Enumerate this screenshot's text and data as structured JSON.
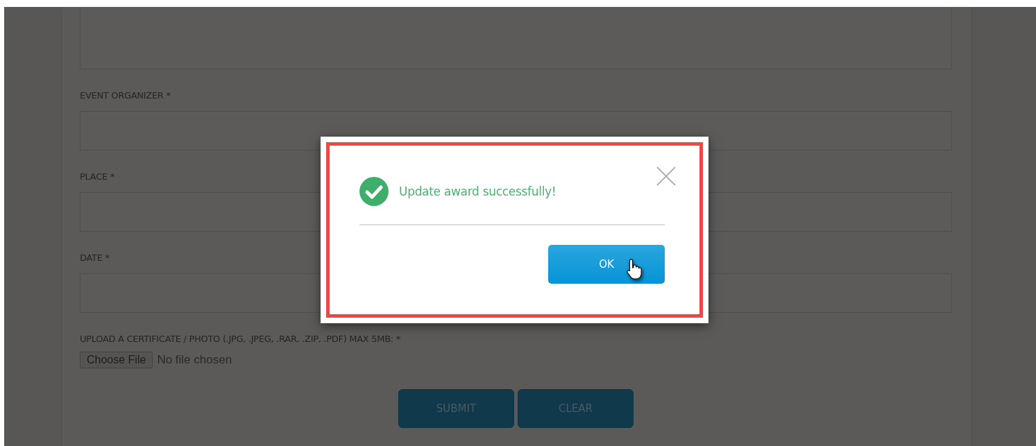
{
  "form": {
    "fields": [
      {
        "kind": "textarea"
      },
      {
        "kind": "text",
        "label": "EVENT ORGANIZER *"
      },
      {
        "kind": "text",
        "label": "PLACE *"
      },
      {
        "kind": "text",
        "label": "DATE *"
      },
      {
        "kind": "file",
        "label": "UPLOAD A CERTIFICATE / PHOTO (.JPG, .JPEG, .RAR, .ZIP, .PDF) MAX 5MB: *",
        "button": "Choose File",
        "status": "No file chosen"
      }
    ],
    "buttons": [
      "SUBMIT",
      "CLEAR"
    ]
  },
  "dialog": {
    "message": "Update award successfully!",
    "button": "OK"
  }
}
